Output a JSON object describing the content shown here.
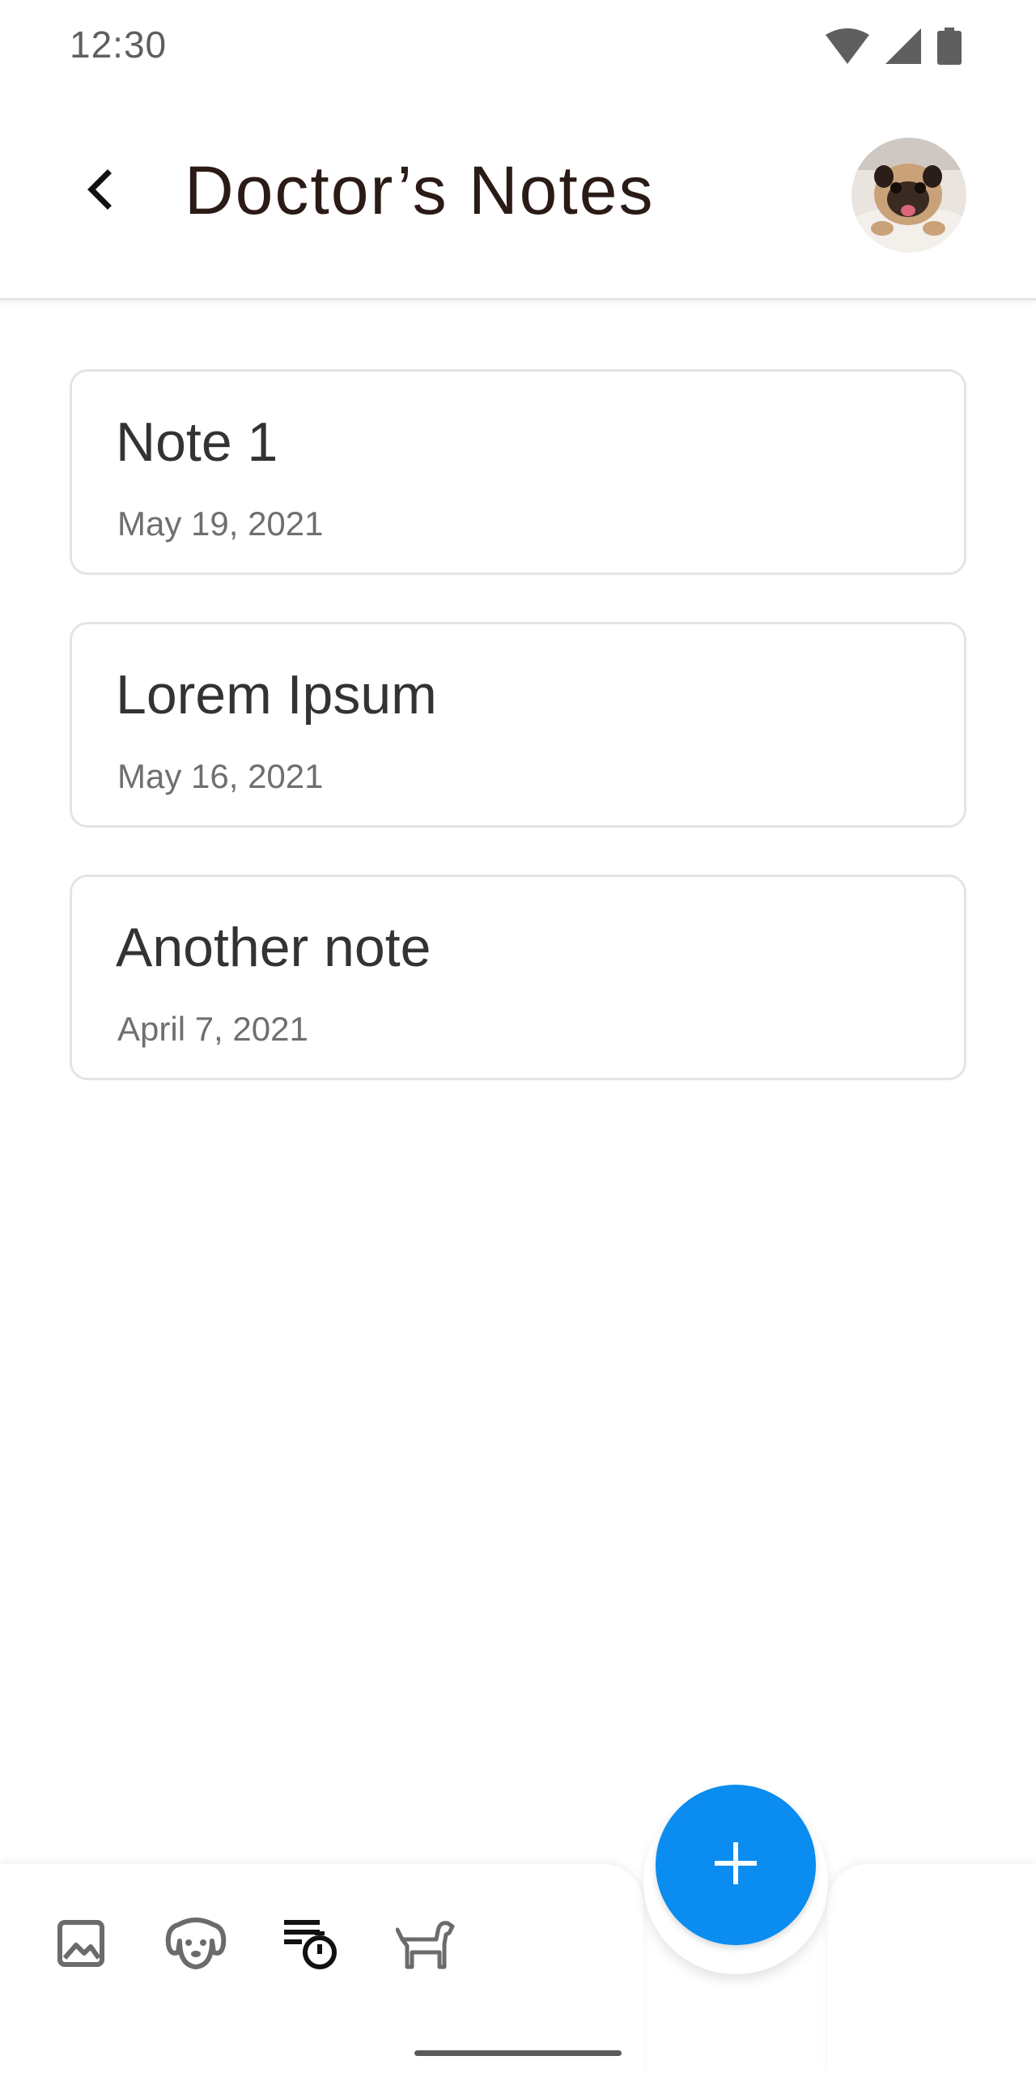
{
  "status_bar": {
    "time": "12:30",
    "icons": [
      "wifi-icon",
      "cellular-signal-icon",
      "battery-icon"
    ]
  },
  "app_bar": {
    "back_icon": "chevron-left-icon",
    "title": "Doctor’s Notes",
    "avatar": "pet-avatar-pug"
  },
  "notes": [
    {
      "title": "Note 1",
      "date": "May 19, 2021"
    },
    {
      "title": "Lorem Ipsum",
      "date": "May 16, 2021"
    },
    {
      "title": "Another note",
      "date": "April 7, 2021"
    }
  ],
  "bottom_nav": {
    "items": [
      {
        "icon": "gallery-icon",
        "active": false
      },
      {
        "icon": "dog-face-icon",
        "active": false
      },
      {
        "icon": "schedule-list-icon",
        "active": true
      },
      {
        "icon": "dog-icon",
        "active": false
      }
    ],
    "fab_icon": "plus-icon"
  },
  "colors": {
    "accent": "#0a8cf0",
    "title_text": "#2b1b17",
    "note_title": "#333333",
    "note_date": "#6f6f6f",
    "card_border": "#e4e4e4",
    "nav_icon_inactive": "#6b6b6b",
    "nav_icon_active": "#111111"
  }
}
